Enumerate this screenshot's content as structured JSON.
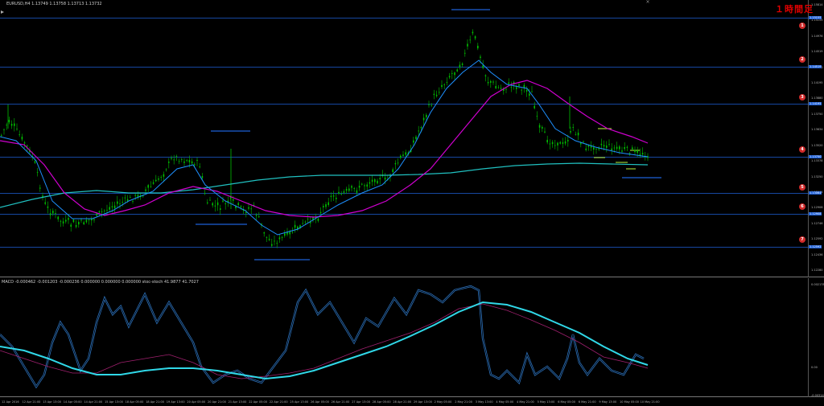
{
  "window": {
    "symbol_title": "EURUSD,H4  1.13749 1.13758 1.13713 1.13732",
    "timeframe_badge": "１時間足",
    "close_symbol": "×"
  },
  "indicator": {
    "title": "MACD -0.000462 -0.001203 -0.000236 0.000000 0.000000 0.000000  stoc-stoch 41.9877 41.7027"
  },
  "price_axis": {
    "labels": [
      "1.15814",
      "1.15155",
      "1.14976",
      "1.14519",
      "1.14350",
      "1.14195",
      "1.13880",
      "1.13750",
      "1.13634",
      "1.13520",
      "1.13378",
      "1.13250",
      "1.13064",
      "1.12908",
      "1.12746",
      "1.12592",
      "1.12436",
      "1.12280"
    ],
    "tags": [
      "1.15155",
      "1.14519",
      "1.14195",
      "1.13750",
      "1.13064",
      "1.12908",
      "1.12592"
    ]
  },
  "sub_axis": {
    "labels": [
      "0.002178",
      "0.00",
      "-0.003149"
    ]
  },
  "level_markers": [
    "1",
    "2",
    "3",
    "4",
    "5",
    "6",
    "7"
  ],
  "time_axis": {
    "labels": [
      "12 Apr 2016",
      "12 Apr 21:00",
      "13 Apr 13:00",
      "14 Apr 05:00",
      "14 Apr 21:00",
      "15 Apr 13:00",
      "18 Apr 05:00",
      "18 Apr 21:00",
      "19 Apr 13:00",
      "20 Apr 05:00",
      "20 Apr 21:00",
      "21 Apr 13:00",
      "22 Apr 05:00",
      "22 Apr 21:00",
      "25 Apr 13:00",
      "26 Apr 05:00",
      "26 Apr 21:00",
      "27 Apr 13:00",
      "28 Apr 05:00",
      "28 Apr 21:00",
      "29 Apr 13:00",
      "2 May 05:00",
      "2 May 21:00",
      "3 May 13:00",
      "4 May 05:00",
      "4 May 21:00",
      "5 May 13:00",
      "6 May 05:00",
      "6 May 21:00",
      "9 May 13:00",
      "10 May 05:00",
      "10 May 21:00"
    ]
  },
  "colors": {
    "candle": "#00c000",
    "ma_fast": "#1e90ff",
    "ma_mid": "#d000d0",
    "ma_slow": "#20c0c0",
    "hline": "#1e5fd6",
    "badge": "#e00000"
  }
}
